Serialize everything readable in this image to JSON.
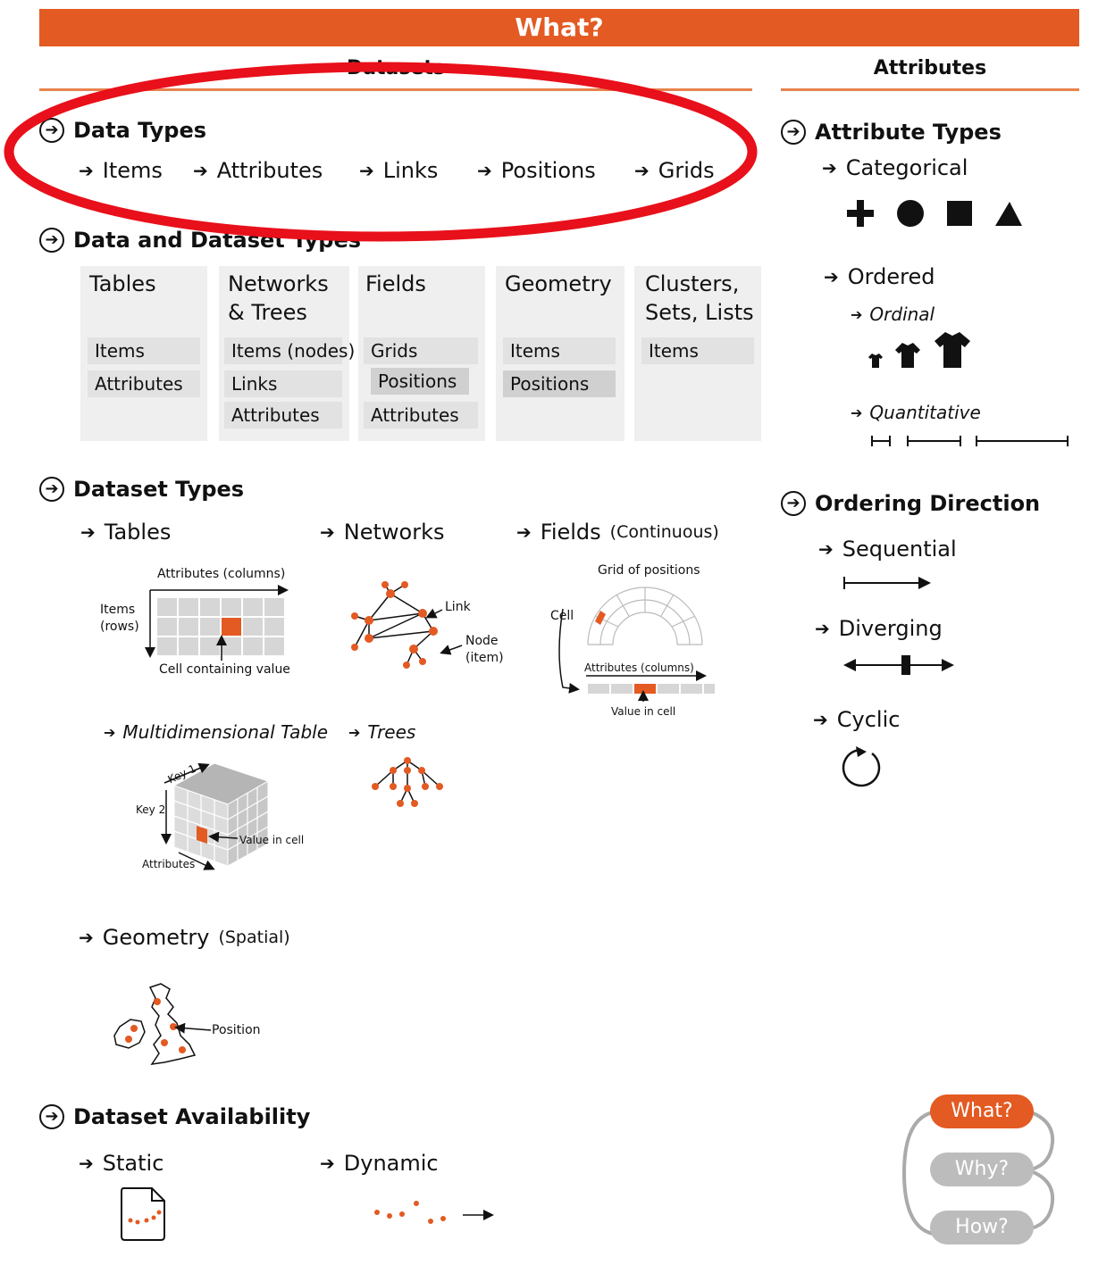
{
  "banner": {
    "title": "What?"
  },
  "columns": {
    "datasets": "Datasets",
    "attributes": "Attributes"
  },
  "data_types": {
    "heading": "Data Types",
    "items": [
      "Items",
      "Attributes",
      "Links",
      "Positions",
      "Grids"
    ]
  },
  "data_dataset_types": {
    "heading": "Data and Dataset Types",
    "boxes": [
      {
        "title": "Tables",
        "cells": [
          "Items",
          "Attributes"
        ]
      },
      {
        "title": "Networks & Trees",
        "cells": [
          "Items (nodes)",
          "Links",
          "Attributes"
        ]
      },
      {
        "title": "Fields",
        "cells": [
          "Grids",
          "Positions",
          "Attributes"
        ]
      },
      {
        "title": "Geometry",
        "cells": [
          "Items",
          "Positions"
        ]
      },
      {
        "title": "Clusters, Sets, Lists",
        "cells": [
          "Items"
        ]
      }
    ]
  },
  "dataset_types": {
    "heading": "Dataset Types",
    "tables": {
      "label": "Tables",
      "cols": "Attributes (columns)",
      "rows": "Items (rows)",
      "cell": "Cell containing value"
    },
    "networks": {
      "label": "Networks",
      "link": "Link",
      "node": "Node (item)"
    },
    "fields": {
      "label": "Fields",
      "paren": "(Continuous)",
      "grid": "Grid of positions",
      "cell": "Cell",
      "cols": "Attributes (columns)",
      "value": "Value in cell"
    },
    "multi": {
      "label": "Multidimensional Table",
      "key1": "Key 1",
      "key2": "Key 2",
      "attrs": "Attributes",
      "value": "Value in cell"
    },
    "trees": {
      "label": "Trees"
    },
    "geometry": {
      "label": "Geometry",
      "paren": "(Spatial)",
      "position": "Position"
    }
  },
  "availability": {
    "heading": "Dataset Availability",
    "static": "Static",
    "dynamic": "Dynamic"
  },
  "attribute_types": {
    "heading": "Attribute Types",
    "categorical": "Categorical",
    "ordered": "Ordered",
    "ordinal": "Ordinal",
    "quantitative": "Quantitative"
  },
  "ordering": {
    "heading": "Ordering Direction",
    "sequential": "Sequential",
    "diverging": "Diverging",
    "cyclic": "Cyclic"
  },
  "nav": {
    "what": "What?",
    "why": "Why?",
    "how": "How?"
  },
  "colors": {
    "accent": "#e35a22",
    "annotation": "#e8101a",
    "cell": "#e2e2e2",
    "box": "#efefef"
  }
}
